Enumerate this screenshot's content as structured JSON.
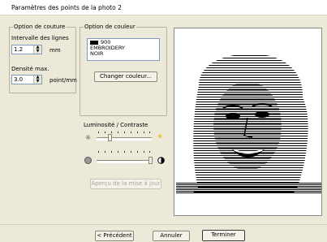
{
  "window": {
    "title": "Paramètres des points de la photo 2"
  },
  "sewing": {
    "legend": "Option de couture",
    "interval_label": "Intervalle des lignes",
    "interval_value": "1.2",
    "interval_unit": "mm",
    "density_label": "Densité max.",
    "density_value": "3.0",
    "density_unit": "point/mm"
  },
  "color": {
    "legend": "Option de couleur",
    "items": [
      "900",
      "EMBROIDERY",
      "NOIR"
    ],
    "swatch_color": "#000000",
    "change_button": "Changer couleur..."
  },
  "brightness": {
    "label": "Luminosité / Contraste",
    "brightness_level": 0.25,
    "contrast_level": 1.0,
    "dim_icon": "sun-dim-icon",
    "bright_icon": "sun-bright-icon",
    "low_contrast_icon": "contrast-low-icon",
    "high_contrast_icon": "contrast-high-icon"
  },
  "preview_update_button": "Aperçu de la mise à jour",
  "footer": {
    "back_button": "< Précédent",
    "cancel_button": "Annuler",
    "finish_button": "Terminer"
  },
  "colors": {
    "dialog_bg": "#ece9d8",
    "bright_sun": "#e8b400"
  }
}
